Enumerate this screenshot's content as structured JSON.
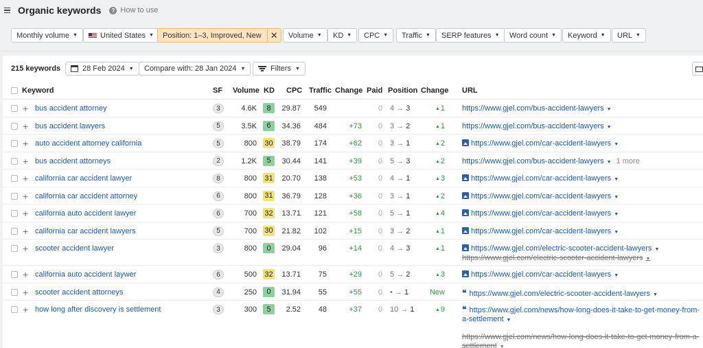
{
  "header": {
    "title": "Organic keywords",
    "how_to_use": "How to use"
  },
  "filters": {
    "monthly_volume": "Monthly volume",
    "country": "United States",
    "position": "Position: 1–3, Improved, New",
    "volume": "Volume",
    "kd": "KD",
    "cpc": "CPC",
    "traffic": "Traffic",
    "serp": "SERP features",
    "word_count": "Word count",
    "keyword": "Keyword",
    "url": "URL"
  },
  "summary": {
    "count": "215 keywords",
    "date": "28 Feb 2024",
    "compare": "Compare with: 28 Jan 2024",
    "filters": "Filters"
  },
  "columns": {
    "keyword": "Keyword",
    "sf": "SF",
    "volume": "Volume",
    "kd": "KD",
    "cpc": "CPC",
    "traffic": "Traffic",
    "change": "Change",
    "paid": "Paid",
    "position": "Position",
    "pos_change": "Change",
    "url": "URL"
  },
  "colors": {
    "kd_green": "#8fd19e",
    "kd_yellow": "#f5e07a",
    "link": "#1a5ab0",
    "positive": "#2e9a3b"
  },
  "rows": [
    {
      "keyword": "bus accident attorney",
      "sf": "3",
      "volume": "4.6K",
      "kd": "8",
      "kd_color": "green",
      "cpc": "29.87",
      "traffic": "549",
      "change": "",
      "paid": "0",
      "pos_from": "4",
      "pos_to": "3",
      "pos_change": "1",
      "url_icon": "",
      "url": "https://www.gjel.com/bus-accident-lawyers",
      "more": "",
      "url_old": ""
    },
    {
      "keyword": "bus accident lawyers",
      "sf": "5",
      "volume": "3.5K",
      "kd": "6",
      "kd_color": "green",
      "cpc": "34.36",
      "traffic": "484",
      "change": "+73",
      "paid": "0",
      "pos_from": "3",
      "pos_to": "2",
      "pos_change": "1",
      "url_icon": "",
      "url": "https://www.gjel.com/bus-accident-lawyers",
      "more": "",
      "url_old": ""
    },
    {
      "keyword": "auto accident attorney california",
      "sf": "5",
      "volume": "800",
      "kd": "30",
      "kd_color": "yellow",
      "cpc": "38.79",
      "traffic": "174",
      "change": "+62",
      "paid": "0",
      "pos_from": "3",
      "pos_to": "1",
      "pos_change": "2",
      "url_icon": "image",
      "url": "https://www.gjel.com/car-accident-lawyers",
      "more": "",
      "url_old": ""
    },
    {
      "keyword": "bus accident attorneys",
      "sf": "2",
      "volume": "1.2K",
      "kd": "5",
      "kd_color": "green",
      "cpc": "30.44",
      "traffic": "141",
      "change": "+39",
      "paid": "0",
      "pos_from": "5",
      "pos_to": "3",
      "pos_change": "2",
      "url_icon": "",
      "url": "https://www.gjel.com/bus-accident-lawyers",
      "more": "1 more",
      "url_old": ""
    },
    {
      "keyword": "california car accident lawyer",
      "sf": "8",
      "volume": "800",
      "kd": "31",
      "kd_color": "yellow",
      "cpc": "20.70",
      "traffic": "138",
      "change": "+53",
      "paid": "0",
      "pos_from": "4",
      "pos_to": "1",
      "pos_change": "3",
      "url_icon": "image",
      "url": "https://www.gjel.com/car-accident-lawyers",
      "more": "",
      "url_old": ""
    },
    {
      "keyword": "california car accident attorney",
      "sf": "6",
      "volume": "800",
      "kd": "31",
      "kd_color": "yellow",
      "cpc": "36.79",
      "traffic": "128",
      "change": "+36",
      "paid": "0",
      "pos_from": "3",
      "pos_to": "1",
      "pos_change": "2",
      "url_icon": "image",
      "url": "https://www.gjel.com/car-accident-lawyers",
      "more": "",
      "url_old": ""
    },
    {
      "keyword": "california auto accident lawyer",
      "sf": "6",
      "volume": "700",
      "kd": "32",
      "kd_color": "yellow",
      "cpc": "13.71",
      "traffic": "121",
      "change": "+58",
      "paid": "0",
      "pos_from": "5",
      "pos_to": "1",
      "pos_change": "4",
      "url_icon": "image",
      "url": "https://www.gjel.com/car-accident-lawyers",
      "more": "",
      "url_old": ""
    },
    {
      "keyword": "california car accident lawyers",
      "sf": "5",
      "volume": "700",
      "kd": "30",
      "kd_color": "yellow",
      "cpc": "21.82",
      "traffic": "102",
      "change": "+15",
      "paid": "0",
      "pos_from": "3",
      "pos_to": "2",
      "pos_change": "1",
      "url_icon": "image",
      "url": "https://www.gjel.com/car-accident-lawyers",
      "more": "",
      "url_old": ""
    },
    {
      "keyword": "scooter accident lawyer",
      "sf": "3",
      "volume": "800",
      "kd": "0",
      "kd_color": "green",
      "cpc": "29.04",
      "traffic": "96",
      "change": "+14",
      "paid": "0",
      "pos_from": "4",
      "pos_to": "3",
      "pos_change": "1",
      "url_icon": "image",
      "url": "https://www.gjel.com/electric-scooter-accident-lawyers",
      "more": "",
      "url_old": "https://www.gjel.com/electric-scooter-accident-lawyers"
    },
    {
      "keyword": "california auto accident laywer",
      "sf": "6",
      "volume": "500",
      "kd": "32",
      "kd_color": "yellow",
      "cpc": "13.71",
      "traffic": "75",
      "change": "+29",
      "paid": "0",
      "pos_from": "5",
      "pos_to": "2",
      "pos_change": "3",
      "url_icon": "image",
      "url": "https://www.gjel.com/car-accident-lawyers",
      "more": "",
      "url_old": ""
    },
    {
      "keyword": "scooter accident attorneys",
      "sf": "4",
      "volume": "250",
      "kd": "0",
      "kd_color": "green",
      "cpc": "31.94",
      "traffic": "55",
      "change": "+55",
      "paid": "0",
      "pos_from": "•",
      "pos_to": "1",
      "pos_change": "New",
      "url_icon": "quote",
      "url": "https://www.gjel.com/electric-scooter-accident-lawyers",
      "more": "",
      "url_old": ""
    },
    {
      "keyword": "how long after discovery is settlement",
      "sf": "3",
      "volume": "300",
      "kd": "5",
      "kd_color": "green",
      "cpc": "2.52",
      "traffic": "48",
      "change": "+37",
      "paid": "0",
      "pos_from": "10",
      "pos_to": "1",
      "pos_change": "9",
      "url_icon": "quote",
      "url": "https://www.gjel.com/news/how-long-does-it-take-to-get-money-from-a-settlement",
      "more": "",
      "url_old": "https://www.gjel.com/news/how-long-does-it-take-to-get-money-from-a-settlement"
    }
  ]
}
